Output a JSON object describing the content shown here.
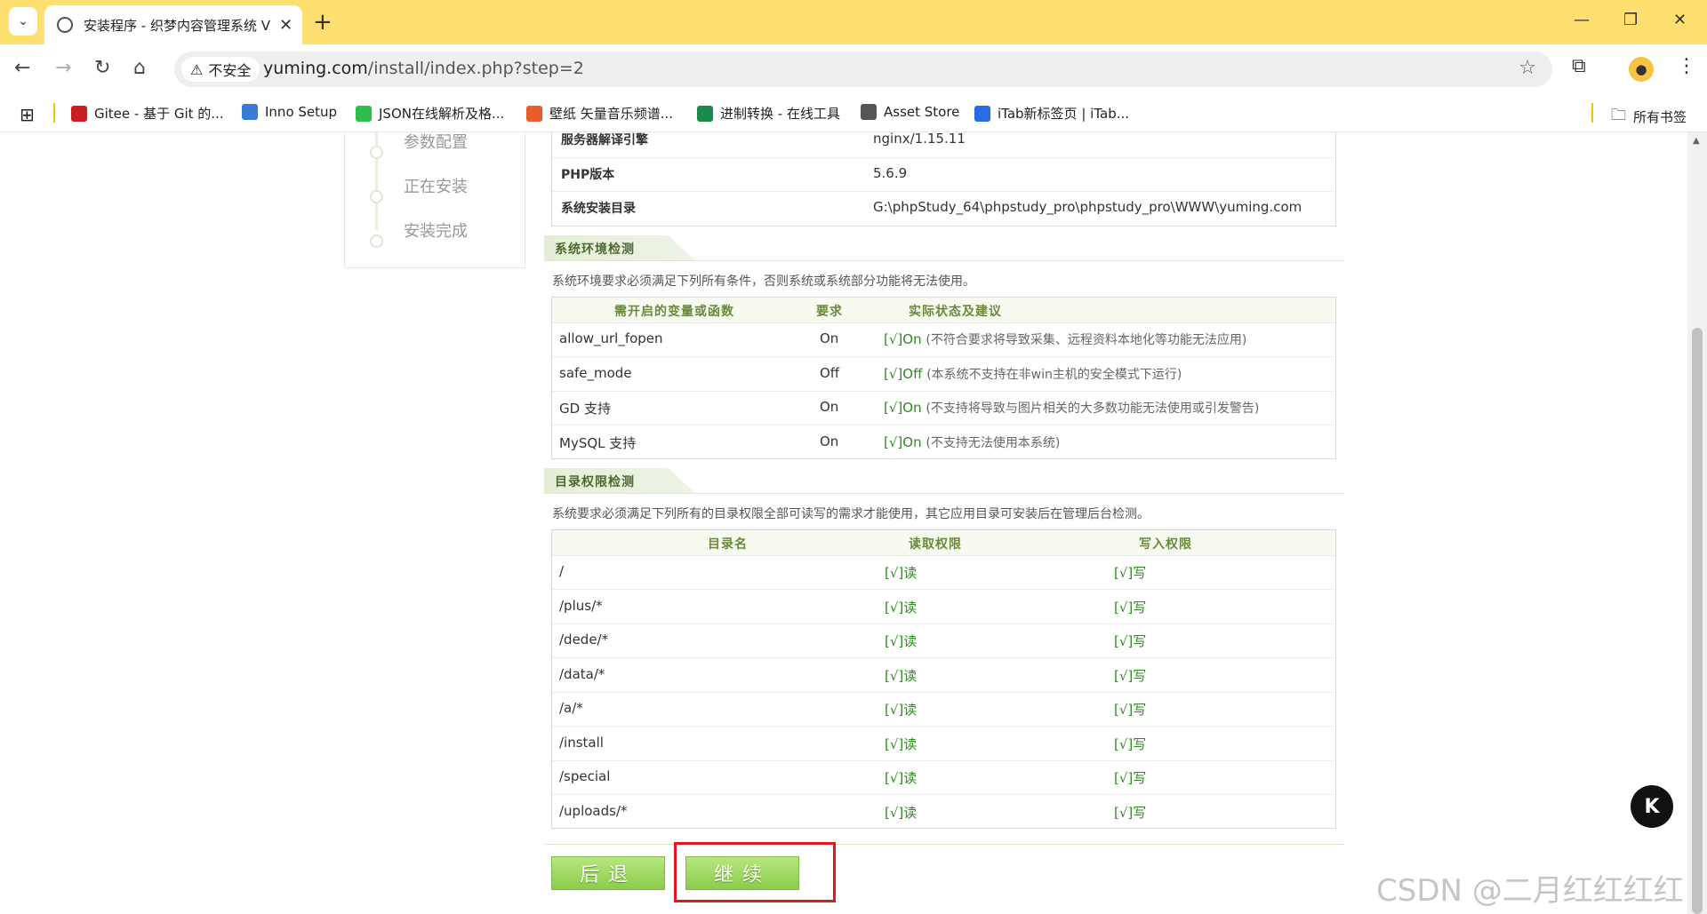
{
  "browser": {
    "tab_title": "安装程序 - 织梦内容管理系统 V",
    "insecure_label": "不安全",
    "url_host": "yuming.com",
    "url_path": "/install/index.php?step=2",
    "bookmarks": [
      {
        "label": "Gitee - 基于 Git 的...",
        "color": "#c71d23"
      },
      {
        "label": "Inno Setup",
        "color": "#3a7bd5"
      },
      {
        "label": "JSON在线解析及格...",
        "color": "#2bbf4a"
      },
      {
        "label": "壁纸 矢量音乐频谱...",
        "color": "#e85b2b"
      },
      {
        "label": "进制转换 - 在线工具",
        "color": "#1a8a4a"
      },
      {
        "label": "Asset Store",
        "color": "#555555"
      },
      {
        "label": "iTab新标签页 | iTab...",
        "color": "#2a6de0"
      }
    ],
    "all_bookmarks": "所有书签"
  },
  "steps": [
    "参数配置",
    "正在安装",
    "安装完成"
  ],
  "server_info": [
    {
      "label": "服务器解译引擎",
      "value": "nginx/1.15.11"
    },
    {
      "label": "PHP版本",
      "value": "5.6.9"
    },
    {
      "label": "系统安装目录",
      "value": "G:\\phpStudy_64\\phpstudy_pro\\phpstudy_pro\\WWW\\yuming.com"
    }
  ],
  "env": {
    "title": "系统环境检测",
    "note": "系统环境要求必须满足下列所有条件，否则系统或系统部分功能将无法使用。",
    "headers": [
      "需开启的变量或函数",
      "要求",
      "实际状态及建议"
    ],
    "rows": [
      {
        "name": "allow_url_fopen",
        "req": "On",
        "status": "[√]On",
        "hint": "(不符合要求将导致采集、远程资料本地化等功能无法应用)"
      },
      {
        "name": "safe_mode",
        "req": "Off",
        "status": "[√]Off",
        "hint": "(本系统不支持在非win主机的安全模式下运行)"
      },
      {
        "name": "GD 支持",
        "req": "On",
        "status": "[√]On",
        "hint": "(不支持将导致与图片相关的大多数功能无法使用或引发警告)"
      },
      {
        "name": "MySQL 支持",
        "req": "On",
        "status": "[√]On",
        "hint": "(不支持无法使用本系统)"
      }
    ]
  },
  "dirs": {
    "title": "目录权限检测",
    "note": "系统要求必须满足下列所有的目录权限全部可读写的需求才能使用，其它应用目录可安装后在管理后台检测。",
    "headers": [
      "目录名",
      "读取权限",
      "写入权限"
    ],
    "rows": [
      {
        "dir": "/",
        "read": "[√]读",
        "write": "[√]写"
      },
      {
        "dir": "/plus/*",
        "read": "[√]读",
        "write": "[√]写"
      },
      {
        "dir": "/dede/*",
        "read": "[√]读",
        "write": "[√]写"
      },
      {
        "dir": "/data/*",
        "read": "[√]读",
        "write": "[√]写"
      },
      {
        "dir": "/a/*",
        "read": "[√]读",
        "write": "[√]写"
      },
      {
        "dir": "/install",
        "read": "[√]读",
        "write": "[√]写"
      },
      {
        "dir": "/special",
        "read": "[√]读",
        "write": "[√]写"
      },
      {
        "dir": "/uploads/*",
        "read": "[√]读",
        "write": "[√]写"
      }
    ]
  },
  "buttons": {
    "back": "后退",
    "next": "继续"
  },
  "float_icon": "K",
  "watermark": "CSDN @二月红红红红"
}
